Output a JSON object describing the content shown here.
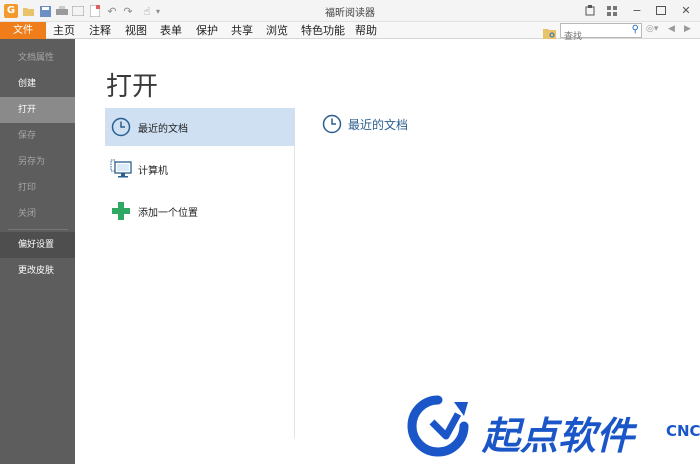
{
  "window": {
    "title": "福昕阅读器"
  },
  "menubar": {
    "file_label": "文件",
    "items": [
      "主页",
      "注释",
      "视图",
      "表单",
      "保护",
      "共享",
      "浏览",
      "特色功能",
      "帮助"
    ],
    "search_placeholder": "查找"
  },
  "sidebar": {
    "items": [
      {
        "label": "文档属性",
        "state": "disabled"
      },
      {
        "label": "创建",
        "state": "normal"
      },
      {
        "label": "打开",
        "state": "active"
      },
      {
        "label": "保存",
        "state": "disabled"
      },
      {
        "label": "另存为",
        "state": "disabled"
      },
      {
        "label": "打印",
        "state": "disabled"
      },
      {
        "label": "关闭",
        "state": "disabled"
      },
      {
        "label": "偏好设置",
        "state": "normal"
      },
      {
        "label": "更改皮肤",
        "state": "normal"
      }
    ]
  },
  "main": {
    "title": "打开",
    "options": [
      {
        "label": "最近的文档",
        "icon": "clock-icon",
        "active": true
      },
      {
        "label": "计算机",
        "icon": "computer-icon",
        "active": false
      },
      {
        "label": "添加一个位置",
        "icon": "plus-icon",
        "active": false
      }
    ],
    "recent_heading": "最近的文档"
  },
  "watermark": {
    "text": "起点软件",
    "sub": "CNC"
  },
  "colors": {
    "accent_orange": "#ef7d1a",
    "sidebar_bg": "#5d5d5d",
    "selection_blue": "#cfe0f3",
    "heading_blue": "#2b5f8f",
    "plus_green": "#2fa864"
  }
}
